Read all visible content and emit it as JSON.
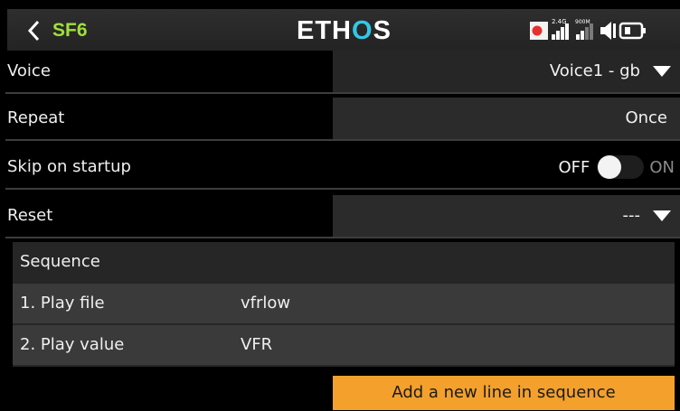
{
  "header": {
    "model_name": "SF6",
    "logo_part1": "ETH",
    "logo_part2": "O",
    "logo_part3": "S",
    "status": {
      "band_24": "2.4G",
      "band_900": "900M",
      "icons": [
        "record-icon",
        "signal-bars-icon",
        "speaker-icon",
        "battery-icon"
      ]
    }
  },
  "rows": {
    "voice": {
      "label": "Voice",
      "value": "Voice1 - gb"
    },
    "repeat": {
      "label": "Repeat",
      "value": "Once"
    },
    "skip": {
      "label": "Skip on startup",
      "off_label": "OFF",
      "on_label": "ON",
      "state": "off"
    },
    "reset": {
      "label": "Reset",
      "value": "---"
    }
  },
  "sequence": {
    "title": "Sequence",
    "items": [
      {
        "index_label": "1. Play file",
        "value": "vfrlow"
      },
      {
        "index_label": "2. Play value",
        "value": "VFR"
      }
    ],
    "add_label": "Add a new line in sequence"
  },
  "colors": {
    "accent": "#9fe03a",
    "logo_accent": "#32c8e6",
    "button": "#f4a02c",
    "record": "#e53030"
  }
}
